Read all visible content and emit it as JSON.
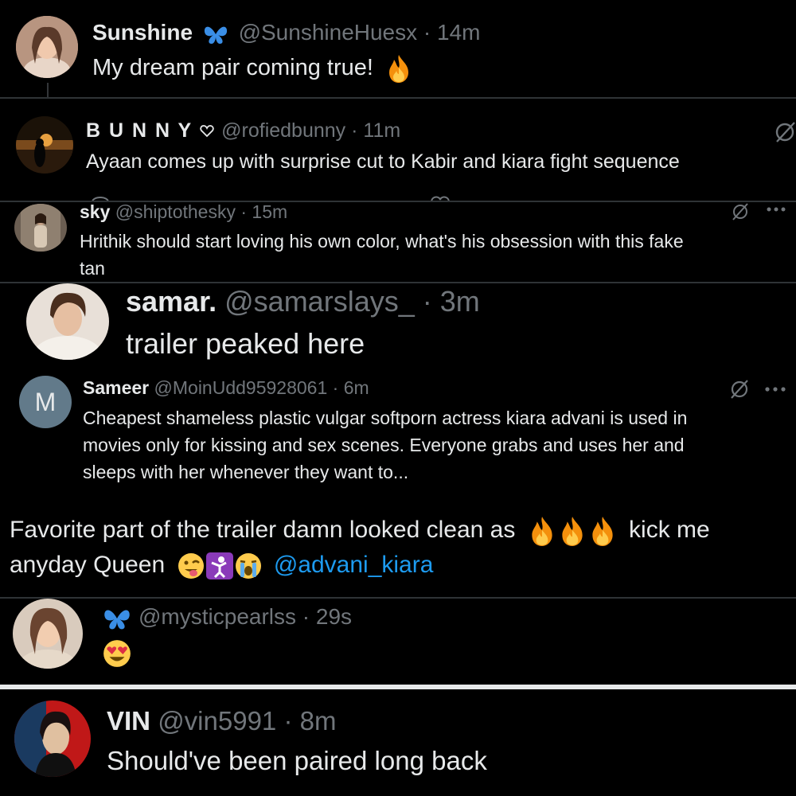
{
  "tweets": [
    {
      "name": "Sunshine",
      "handle": "@SunshineHuesx",
      "time": "14m",
      "text": "My dream pair coming true!",
      "emoji": "fire-emoji"
    },
    {
      "name": "B U N N Y",
      "handle": "@rofiedbunny",
      "time": "11m",
      "text": "Ayaan comes up with surprise cut to Kabir and kiara fight sequence"
    },
    {
      "name": "sky",
      "handle": "@shiptothesky",
      "time": "15m",
      "text_line1": "Hrithik should start loving his own color, what's his obsession with this fake",
      "text_line2": "tan"
    },
    {
      "name": "samar.",
      "handle": "@samarslays_",
      "time": "3m",
      "text": "trailer peaked here"
    },
    {
      "name": "Sameer",
      "avatar_letter": "M",
      "handle": "@MoinUdd95928061",
      "time": "6m",
      "text_line1": "Cheapest shameless plastic vulgar softporn actress kiara advani is used in",
      "text_line2": "movies only for kissing and sex scenes. Everyone grabs and uses her and",
      "text_line3": "sleeps with her whenever they want to..."
    },
    {
      "text_line1": "Favorite part of the trailer damn looked clean as",
      "text_line1_after": "kick me",
      "text_line2": "anyday Queen",
      "mention": "@advani_kiara"
    },
    {
      "handle": "@mysticpearlss",
      "time": "29s",
      "emoji": "heart-eyes-emoji"
    },
    {
      "name": "VIN",
      "handle": "@vin5991",
      "time": "8m",
      "text": "Should've been paired long back"
    }
  ],
  "separator": "·",
  "colors": {
    "background": "#000000",
    "text": "#e7e9ea",
    "secondary": "#71767b",
    "link": "#1d9bf0",
    "divider": "#2f3336"
  }
}
